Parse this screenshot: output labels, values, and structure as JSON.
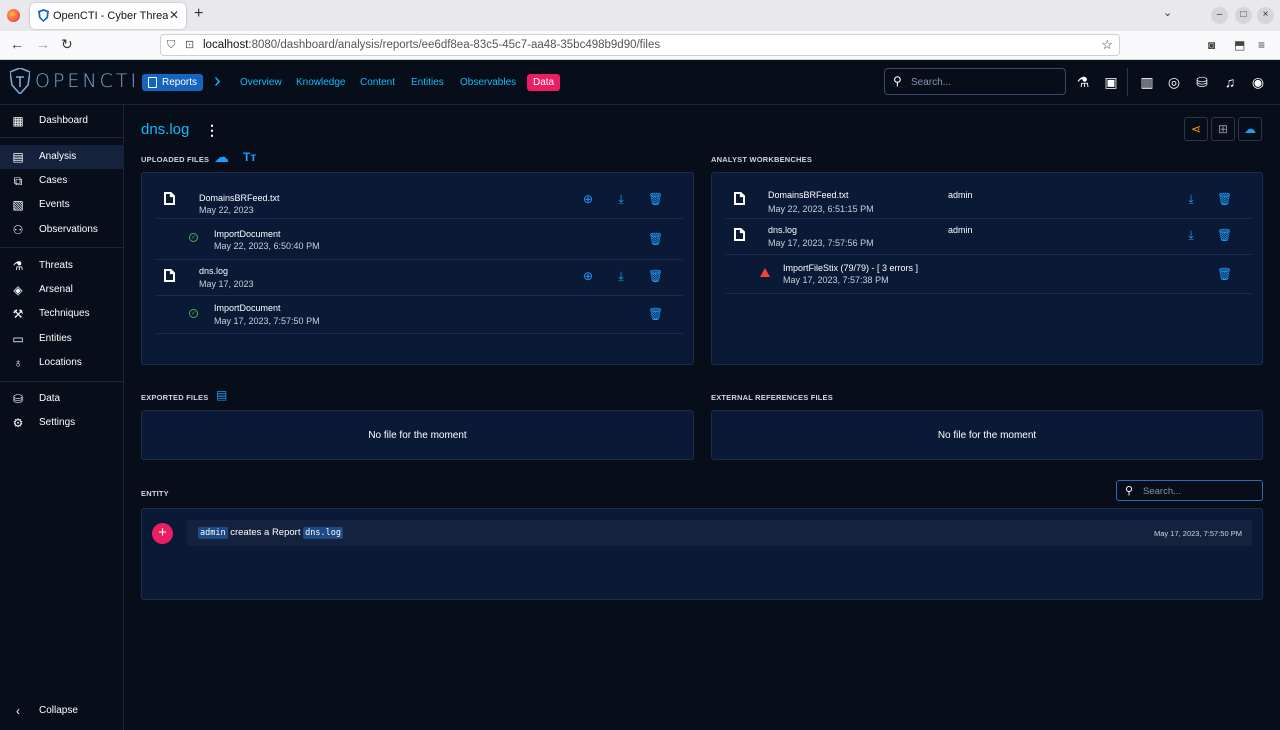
{
  "browser": {
    "tab_title": "OpenCTI - Cyber Threat Intelligence",
    "tab_close": "✕",
    "new_tab": "+",
    "url_host": "localhost",
    "url_rest": ":8080/dashboard/analysis/reports/ee6df8ea-83c5-45c7-aa48-35bc498b9d90/files"
  },
  "app": {
    "logo_text": "OPENCTI",
    "breadcrumb_reports": "Reports",
    "nav_links": [
      "Overview",
      "Knowledge",
      "Content",
      "Entities",
      "Observables"
    ],
    "nav_active": "Data",
    "search_placeholder": "Search..."
  },
  "sidebar": {
    "items": [
      {
        "label": "Dashboard",
        "icon": "dashboard-icon"
      },
      {
        "label": "Analysis",
        "icon": "analysis-icon"
      },
      {
        "label": "Cases",
        "icon": "cases-icon"
      },
      {
        "label": "Events",
        "icon": "events-icon"
      },
      {
        "label": "Observations",
        "icon": "binoculars-icon"
      },
      {
        "label": "Threats",
        "icon": "flask-icon"
      },
      {
        "label": "Arsenal",
        "icon": "layers-icon"
      },
      {
        "label": "Techniques",
        "icon": "tools-icon"
      },
      {
        "label": "Entities",
        "icon": "folder-icon"
      },
      {
        "label": "Locations",
        "icon": "globe-icon"
      },
      {
        "label": "Data",
        "icon": "database-icon"
      },
      {
        "label": "Settings",
        "icon": "gear-icon"
      }
    ],
    "collapse": "Collapse"
  },
  "page": {
    "title": "dns.log",
    "uploaded_title": "UPLOADED FILES",
    "workbenches_title": "ANALYST WORKBENCHES",
    "exported_title": "EXPORTED FILES",
    "extref_title": "EXTERNAL REFERENCES FILES",
    "entity_title": "ENTITY",
    "no_file": "No file for the moment",
    "entity_search_placeholder": "Search..."
  },
  "uploaded": [
    {
      "name": "DomainsBRFeed.txt",
      "date": "May 22, 2023",
      "job": "ImportDocument",
      "job_date": "May 22, 2023, 6:50:40 PM"
    },
    {
      "name": "dns.log",
      "date": "May 17, 2023",
      "job": "ImportDocument",
      "job_date": "May 17, 2023, 7:57:50 PM"
    }
  ],
  "workbenches": [
    {
      "name": "DomainsBRFeed.txt",
      "date": "May 22, 2023, 6:51:15 PM",
      "user": "admin"
    },
    {
      "name": "dns.log",
      "date": "May 17, 2023, 7:57:56 PM",
      "user": "admin",
      "job": "ImportFileStix (79/79) - [ 3 errors ]",
      "job_date": "May 17, 2023, 7:57:38 PM"
    }
  ],
  "history": {
    "user": "admin",
    "action": "creates a Report",
    "entity": "dns.log",
    "date": "May 17, 2023, 7:57:50 PM"
  },
  "colors": {
    "accent": "#0fbcff",
    "button_blue": "#1e9dfb",
    "data_badge": "#e91e63",
    "panel": "#0a1a36"
  }
}
